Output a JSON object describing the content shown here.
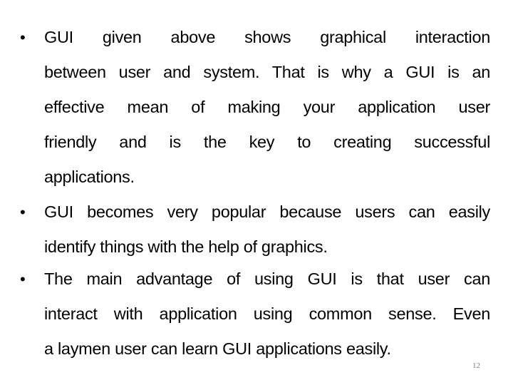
{
  "slide": {
    "bullets": [
      {
        "lines": [
          "GUI given above shows graphical interaction",
          "between user and system. That is why a GUI is an",
          "effective mean of making your application user",
          "friendly and is the key to creating successful",
          "applications."
        ]
      },
      {
        "lines": [
          "GUI becomes very popular because users can easily",
          "identify things with the help of graphics."
        ]
      },
      {
        "lines": [
          "The main advantage of using GUI is that user can",
          "interact with application using common sense. Even",
          "a laymen user can learn GUI applications easily."
        ]
      }
    ],
    "bullet_glyph": "•",
    "page_number": "12"
  }
}
